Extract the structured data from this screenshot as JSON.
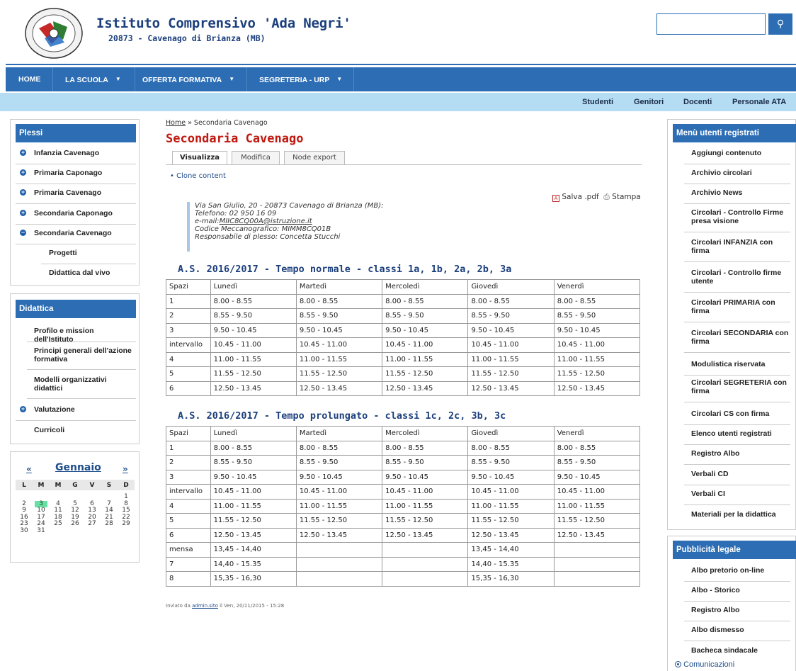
{
  "header": {
    "title": "Istituto Comprensivo 'Ada Negri'",
    "subtitle": "20873 - Cavenago di Brianza (MB)",
    "search_placeholder": ""
  },
  "nav": [
    {
      "label": "HOME",
      "caret": false
    },
    {
      "label": "LA SCUOLA",
      "caret": true
    },
    {
      "label": "OFFERTA FORMATIVA",
      "caret": true
    },
    {
      "label": "SEGRETERIA - URP",
      "caret": true
    }
  ],
  "subnav": [
    "Studenti",
    "Genitori",
    "Docenti",
    "Personale ATA"
  ],
  "left": {
    "plessi_title": "Plessi",
    "plessi": [
      {
        "label": "Infanzia Cavenago",
        "icon": "plus"
      },
      {
        "label": "Primaria Caponago",
        "icon": "plus"
      },
      {
        "label": "Primaria Cavenago",
        "icon": "plus"
      },
      {
        "label": "Secondaria Caponago",
        "icon": "plus"
      },
      {
        "label": "Secondaria Cavenago",
        "icon": "minus"
      },
      {
        "label": "Progetti",
        "icon": ""
      },
      {
        "label": "Didattica dal vivo",
        "icon": ""
      }
    ],
    "didattica_title": "Didattica",
    "didattica": [
      {
        "label": "Profilo e mission dell'Istituto",
        "icon": ""
      },
      {
        "label": "Principi generali dell'azione formativa",
        "icon": ""
      },
      {
        "label": "Modelli organizzativi didattici",
        "icon": ""
      },
      {
        "label": "Valutazione",
        "icon": "plus"
      },
      {
        "label": "Curricoli",
        "icon": ""
      }
    ]
  },
  "calendar": {
    "prev": "«",
    "next": "»",
    "month": "Gennaio",
    "weekdays": [
      "L",
      "M",
      "M",
      "G",
      "V",
      "S",
      "D"
    ],
    "weeks": [
      [
        "",
        "",
        "",
        "",
        "",
        "",
        "1"
      ],
      [
        "2",
        "3",
        "4",
        "5",
        "6",
        "7",
        "8"
      ],
      [
        "9",
        "10",
        "11",
        "12",
        "13",
        "14",
        "15"
      ],
      [
        "16",
        "17",
        "18",
        "19",
        "20",
        "21",
        "22"
      ],
      [
        "23",
        "24",
        "25",
        "26",
        "27",
        "28",
        "29"
      ],
      [
        "30",
        "31",
        "",
        "",
        "",
        "",
        ""
      ]
    ],
    "today": "3",
    "today_color": "#66e0a3"
  },
  "content": {
    "breadcrumb_home": "Home",
    "breadcrumb_sep": " » ",
    "breadcrumb_current": "Secondaria Cavenago",
    "title": "Secondaria Cavenago",
    "tabs": [
      "Visualizza",
      "Modifica",
      "Node export"
    ],
    "clone": "Clone content",
    "save_pdf": "Salva .pdf",
    "print": "Stampa",
    "address": {
      "line1": "Via San Giulio, 20 - 20873 Cavenago di Brianza (MB):",
      "line2": "Telefono: 02 950 16 09",
      "email_label": "e-mail:",
      "email": "MIIC8CQ00A@istruzione.it",
      "line4": "Codice Meccanografico: MIMM8CQ01B",
      "line5": "Responsabile di plesso: Concetta Stucchi"
    },
    "table1_title": "A.S. 2016/2017 - Tempo normale - classi 1a, 1b, 2a, 2b, 3a",
    "table2_title": "A.S. 2016/2017 - Tempo prolungato - classi 1c, 2c, 3b, 3c",
    "headers": [
      "Spazi",
      "Lunedì",
      "Martedì",
      "Mercoledì",
      "Giovedì",
      "Venerdì"
    ],
    "table1": [
      [
        "1",
        "8.00 - 8.55",
        "8.00 - 8.55",
        "8.00 - 8.55",
        "8.00 - 8.55",
        "8.00 - 8.55"
      ],
      [
        "2",
        "8.55 - 9.50",
        "8.55 - 9.50",
        "8.55 - 9.50",
        "8.55 - 9.50",
        "8.55 - 9.50"
      ],
      [
        "3",
        "9.50 - 10.45",
        "9.50 - 10.45",
        "9.50 - 10.45",
        "9.50 - 10.45",
        "9.50 - 10.45"
      ],
      [
        "intervallo",
        "10.45 - 11.00",
        "10.45 - 11.00",
        "10.45 - 11.00",
        "10.45 - 11.00",
        "10.45 - 11.00"
      ],
      [
        "4",
        "11.00 - 11.55",
        "11.00 - 11.55",
        "11.00 - 11.55",
        "11.00 - 11.55",
        "11.00 - 11.55"
      ],
      [
        "5",
        "11.55 - 12.50",
        "11.55 - 12.50",
        "11.55 - 12.50",
        "11.55 - 12.50",
        "11.55 - 12.50"
      ],
      [
        "6",
        "12.50 - 13.45",
        "12.50 - 13.45",
        "12.50 - 13.45",
        "12.50 - 13.45",
        "12.50 - 13.45"
      ]
    ],
    "table2": [
      [
        "1",
        "8.00 - 8.55",
        "8.00 - 8.55",
        "8.00 - 8.55",
        "8.00 - 8.55",
        "8.00 - 8.55"
      ],
      [
        "2",
        "8.55 - 9.50",
        "8.55 - 9.50",
        "8.55 - 9.50",
        "8.55 - 9.50",
        "8.55 - 9.50"
      ],
      [
        "3",
        "9.50 - 10.45",
        "9.50 - 10.45",
        "9.50 - 10.45",
        "9.50 - 10.45",
        "9.50 - 10.45"
      ],
      [
        "intervallo",
        "10.45 - 11.00",
        "10.45 - 11.00",
        "10.45 - 11.00",
        "10.45 - 11.00",
        "10.45 - 11.00"
      ],
      [
        "4",
        "11.00 - 11.55",
        "11.00 - 11.55",
        "11.00 - 11.55",
        "11.00 - 11.55",
        "11.00 - 11.55"
      ],
      [
        "5",
        "11.55 - 12.50",
        "11.55 - 12.50",
        "11.55 - 12.50",
        "11.55 - 12.50",
        "11.55 - 12.50"
      ],
      [
        "6",
        "12.50 - 13.45",
        "12.50 - 13.45",
        "12.50 - 13.45",
        "12.50 - 13.45",
        "12.50 - 13.45"
      ],
      [
        "mensa",
        "13,45 - 14,40",
        "",
        "",
        "13,45 - 14,40",
        ""
      ],
      [
        "7",
        "14,40 - 15.35",
        "",
        "",
        "14,40 - 15.35",
        ""
      ],
      [
        "8",
        "15,35 - 16,30",
        "",
        "",
        "15,35 - 16,30",
        ""
      ]
    ],
    "footer_prefix": "Inviato da ",
    "footer_user": "admin.sito",
    "footer_suffix": " il Ven, 20/11/2015 - 15:28"
  },
  "right": {
    "users_title": "Menù utenti registrati",
    "users": [
      "Aggiungi contenuto",
      "Archivio circolari",
      "Archivio News",
      "Circolari - Controllo Firme presa visione",
      "Circolari INFANZIA con firma",
      "Circolari - Controllo firme utente",
      "Circolari PRIMARIA con firma",
      "Circolari SECONDARIA con firma",
      "Modulistica riservata",
      "Circolari SEGRETERIA con firma",
      "Circolari CS con firma",
      "Elenco utenti registrati",
      "Registro Albo",
      "Verbali CD",
      "Verbali CI",
      "Materiali per la didattica"
    ],
    "legal_title": "Pubblicità legale",
    "legal": [
      "Albo pretorio on-line",
      "Albo - Storico",
      "Registro Albo",
      "Albo dismesso",
      "Bacheca sindacale"
    ],
    "comunicazioni": "Comunicazioni"
  },
  "colors": {
    "brand_blue": "#2c6db4",
    "subbar": "#b4dcf3",
    "title_red": "#c0170e",
    "heading_navy": "#1c3f7c"
  }
}
